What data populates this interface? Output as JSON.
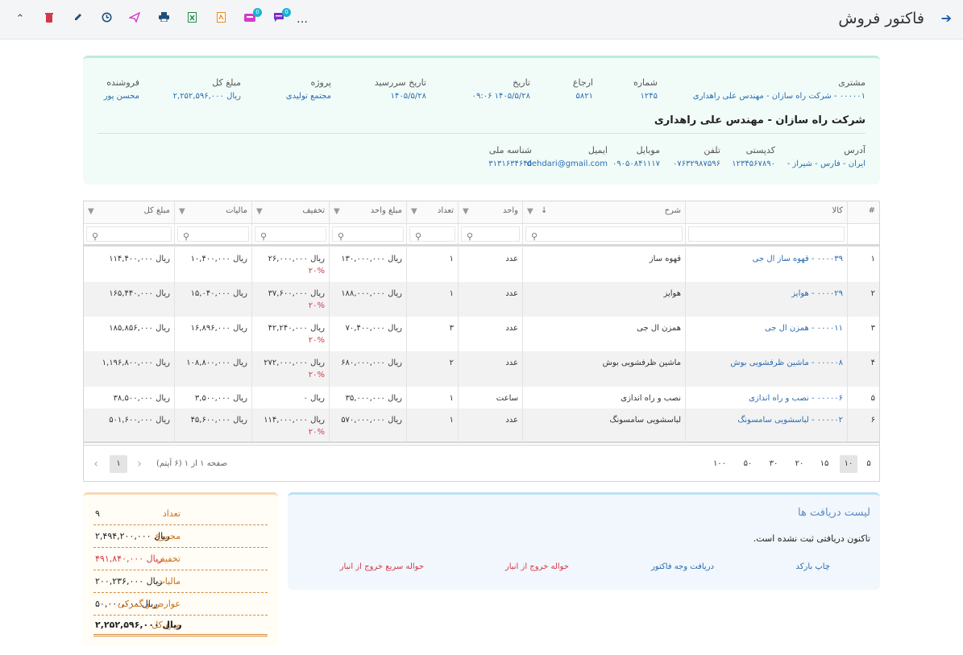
{
  "window": {
    "title": "فاکتور فروش"
  },
  "toolbar": {
    "more": "…",
    "badge_1": "0",
    "badge_2": "0",
    "icons": [
      "collapse-icon",
      "delete-icon",
      "edit-icon",
      "history-icon",
      "send-icon",
      "print-icon",
      "excel-icon",
      "pdf-icon",
      "inbox-icon",
      "chat-icon",
      "more-icon"
    ]
  },
  "header": {
    "customer_label": "مشتری",
    "customer_value": "۰۰۰۰۰۱ - شرکت راه سازان - مهندس علی راهداری",
    "number_label": "شماره",
    "number_value": "۱۲۴۵",
    "ref_label": "ارجاع",
    "ref_value": "۵۸۲۱",
    "date_label": "تاریخ",
    "date_value": "۱۴۰۵/۵/۲۸  ۰۹:۰۶",
    "due_label": "تاریخ سررسید",
    "due_value": "۱۴۰۵/۵/۲۸",
    "project_label": "پروژه",
    "project_value": "مجتمع تولیدی",
    "total_label": "مبلغ کل",
    "total_value": "ریال ۲,۲۵۲,۵۹۶,۰۰۰",
    "seller_label": "فروشنده",
    "seller_value": "محسن پور",
    "customer_name": "شرکت راه سازان - مهندس علی راهداری",
    "address_label": "آدرس",
    "address_value": "ایران - فارس - شیراز -",
    "postal_label": "کدپستی",
    "postal_value": "۱۲۳۴۵۶۷۸۹۰",
    "phone_label": "تلفن",
    "phone_value": "۰۷۶۳۲۹۸۷۵۹۶",
    "mobile_label": "موبایل",
    "mobile_value": "۰۹۰۵۰۸۴۱۱۱۷",
    "email_label": "ایمیل",
    "email_value": "dehdari@gmail.com",
    "national_label": "شناسه ملی",
    "national_value": "۳۱۳۱۶۳۴۶۴۵"
  },
  "table": {
    "columns": [
      "#",
      "کالا",
      "شرح",
      "واحد",
      "تعداد",
      "مبلغ واحد",
      "تخفیف",
      "مالیات",
      "مبلغ کل"
    ],
    "rows": [
      {
        "n": "۱",
        "item": "۰۰۰۰۳۹ - قهوه ساز ال جی",
        "desc": "قهوه ساز",
        "unit": "عدد",
        "qty": "۱",
        "price": "ریال ۱۳۰,۰۰۰,۰۰۰",
        "disc": "ریال ۲۶,۰۰۰,۰۰۰",
        "disc_pct": "۲۰%",
        "tax": "ریال ۱۰,۴۰۰,۰۰۰",
        "total": "ریال ۱۱۴,۴۰۰,۰۰۰"
      },
      {
        "n": "۲",
        "item": "۰۰۰۰۲۹ - هوایز",
        "desc": "هوایز",
        "unit": "عدد",
        "qty": "۱",
        "price": "ریال ۱۸۸,۰۰۰,۰۰۰",
        "disc": "ریال ۳۷,۶۰۰,۰۰۰",
        "disc_pct": "۲۰%",
        "tax": "ریال ۱۵,۰۴۰,۰۰۰",
        "total": "ریال ۱۶۵,۴۴۰,۰۰۰"
      },
      {
        "n": "۳",
        "item": "۰۰۰۰۱۱ - همزن ال جی",
        "desc": "همزن ال جی",
        "unit": "عدد",
        "qty": "۳",
        "price": "ریال ۷۰,۴۰۰,۰۰۰",
        "disc": "ریال ۴۲,۲۴۰,۰۰۰",
        "disc_pct": "۲۰%",
        "tax": "ریال ۱۶,۸۹۶,۰۰۰",
        "total": "ریال ۱۸۵,۸۵۶,۰۰۰"
      },
      {
        "n": "۴",
        "item": "۰۰۰۰۰۸ - ماشین ظرفشویی بوش",
        "desc": "ماشین ظرفشویی بوش",
        "unit": "عدد",
        "qty": "۲",
        "price": "ریال ۶۸۰,۰۰۰,۰۰۰",
        "disc": "ریال ۲۷۲,۰۰۰,۰۰۰",
        "disc_pct": "۲۰%",
        "tax": "ریال ۱۰۸,۸۰۰,۰۰۰",
        "total": "ریال ۱,۱۹۶,۸۰۰,۰۰۰"
      },
      {
        "n": "۵",
        "item": "۰۰۰۰۰۶ - نصب و راه اندازی",
        "desc": "نصب و راه اندازی",
        "unit": "ساعت",
        "qty": "۱",
        "price": "ریال ۳۵,۰۰۰,۰۰۰",
        "disc": "ریال ۰",
        "disc_pct": "",
        "tax": "ریال ۳,۵۰۰,۰۰۰",
        "total": "ریال ۳۸,۵۰۰,۰۰۰"
      },
      {
        "n": "۶",
        "item": "۰۰۰۰۰۲ - لباسشویی سامسونگ",
        "desc": "لباسشویی سامسونگ",
        "unit": "عدد",
        "qty": "۱",
        "price": "ریال ۵۷۰,۰۰۰,۰۰۰",
        "disc": "ریال ۱۱۴,۰۰۰,۰۰۰",
        "disc_pct": "۲۰%",
        "tax": "ریال ۴۵,۶۰۰,۰۰۰",
        "total": "ریال ۵۰۱,۶۰۰,۰۰۰"
      }
    ]
  },
  "pager": {
    "sizes": [
      "۵",
      "۱۰",
      "۱۵",
      "۲۰",
      "۳۰",
      "۵۰",
      "۱۰۰"
    ],
    "selected_size": "۱۰",
    "info": "صفحه ۱ از ۱ (۶ آیتم)",
    "current_page": "۱"
  },
  "payments": {
    "title": "لیست دریافت ها",
    "message": "تاکنون دریافتی ثبت نشده است.",
    "actions": [
      "چاپ بارکد",
      "دریافت وجه فاکتور",
      "حواله خروج از انبار",
      "حواله سریع خروج از انبار"
    ]
  },
  "summary": {
    "count_label": "تعداد",
    "count_value": "۹",
    "sum_label": "مجموع",
    "sum_value": "ریال ۲,۴۹۴,۲۰۰,۰۰۰",
    "disc_label": "تخفیف",
    "disc_value": "ریال ۴۹۱,۸۴۰,۰۰۰",
    "tax_label": "مالیات",
    "tax_value": "ریال ۲۰۰,۲۳۶,۰۰۰",
    "duty_label": "عوارض و گمرکی",
    "duty_value": "ریال ۵۰,۰۰۰,۰۰۰",
    "total_label": "مبلغ کل",
    "total_value": "ریال ۲,۲۵۲,۵۹۶,۰۰۰"
  },
  "colors": {
    "accent": "#2b6cb0",
    "danger": "#d1394a",
    "orange": "#cc6f1d"
  }
}
